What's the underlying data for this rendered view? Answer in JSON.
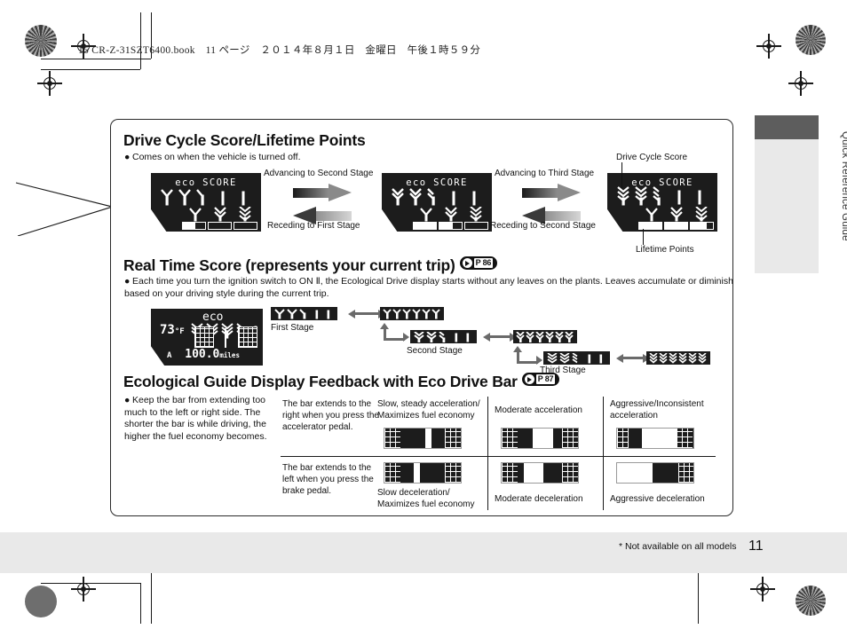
{
  "print_header": "15 CR-Z-31SZT6400.book　11 ページ　２０１４年８月１日　金曜日　午後１時５９分",
  "side_tab": {
    "label": "Quick Reference Guide"
  },
  "footer": {
    "note": "* Not available on all models",
    "page_number": "11"
  },
  "sections": [
    {
      "id": "drive-cycle-score",
      "heading": "Drive Cycle Score/Lifetime Points",
      "bullet": "Comes on when the vehicle is turned off.",
      "displays": [
        {
          "title": "eco SCORE",
          "stage": 1,
          "top_leaves": [
            "sprout",
            "sprout",
            "half"
          ],
          "top_stems": 2,
          "bar_segments": 3,
          "bar_filled": 0.55
        },
        {
          "title": "eco SCORE",
          "stage": 2,
          "top_leaves": [
            "leaf",
            "leaf",
            "halfleaf"
          ],
          "top_stems": 2,
          "bar_segments": 3,
          "bar_filled": 1.6
        },
        {
          "title": "eco SCORE",
          "stage": 3,
          "top_leaves": [
            "full",
            "full",
            "halffull"
          ],
          "top_stems": 2,
          "bar_segments": 3,
          "bar_filled": 2.7
        }
      ],
      "transitions": [
        {
          "forward": "Advancing to Second Stage",
          "backward": "Receding to First Stage"
        },
        {
          "forward": "Advancing to Third Stage",
          "backward": "Receding to Second Stage"
        }
      ],
      "callouts": {
        "top": "Drive Cycle Score",
        "bottom": "Lifetime Points"
      }
    },
    {
      "id": "real-time-score",
      "heading": "Real Time Score (represents your current trip)",
      "page_ref": "P 86",
      "page_ref_num": "86",
      "bullet": "Each time you turn the ignition switch to ON Ⅱ, the Ecological Drive display starts without any leaves on the plants. Leaves accumulate or diminish based on your driving style during the current trip.",
      "cluster": {
        "temp": "73",
        "temp_unit": "°F",
        "eco_label": "eco",
        "trip_label": "A",
        "odometer": "100.0",
        "odometer_unit": "miles"
      },
      "stages": [
        {
          "label": "First Stage",
          "icons": 3,
          "blanks": 3,
          "type": "sprout"
        },
        {
          "label": "",
          "icons": 6,
          "blanks": 0,
          "type": "sprout"
        },
        {
          "label": "Second Stage",
          "icons": 3,
          "blanks": 3,
          "type": "leaf"
        },
        {
          "label": "",
          "icons": 6,
          "blanks": 0,
          "type": "leaf"
        },
        {
          "label": "Third Stage",
          "icons": 3,
          "blanks": 3,
          "type": "full"
        },
        {
          "label": "",
          "icons": 6,
          "blanks": 0,
          "type": "full"
        }
      ]
    },
    {
      "id": "eco-drive-bar",
      "heading": "Ecological Guide Display Feedback with Eco Drive Bar",
      "page_ref": "P 87",
      "page_ref_num": "87",
      "bullet": "Keep the bar from extending too much to the left or right side. The shorter the bar is while driving, the higher the fuel economy becomes.",
      "rows": [
        {
          "description": "The bar extends to the right when you press the accelerator pedal.",
          "cells": [
            {
              "label": "Slow, steady acceleration/ Maximizes fuel economy",
              "label_position": "above",
              "direction": "right",
              "extent": "small"
            },
            {
              "label": "Moderate acceleration",
              "label_position": "above",
              "direction": "right",
              "extent": "medium"
            },
            {
              "label": "Aggressive/Inconsistent acceleration",
              "label_position": "above",
              "direction": "right",
              "extent": "large"
            }
          ]
        },
        {
          "description": "The bar extends to the left when you press the brake pedal.",
          "cells": [
            {
              "label": "Slow deceleration/ Maximizes fuel economy",
              "label_position": "below",
              "direction": "left",
              "extent": "small"
            },
            {
              "label": "Moderate deceleration",
              "label_position": "below",
              "direction": "left",
              "extent": "medium"
            },
            {
              "label": "Aggressive deceleration",
              "label_position": "below",
              "direction": "left",
              "extent": "large"
            }
          ]
        }
      ]
    }
  ],
  "colors": {
    "ink": "#111111",
    "lcd_bg": "#1c1c1c",
    "band": "#e9e9e9",
    "tab_cap": "#5d5d5d",
    "arrow_gray": "#8e8e8e"
  }
}
